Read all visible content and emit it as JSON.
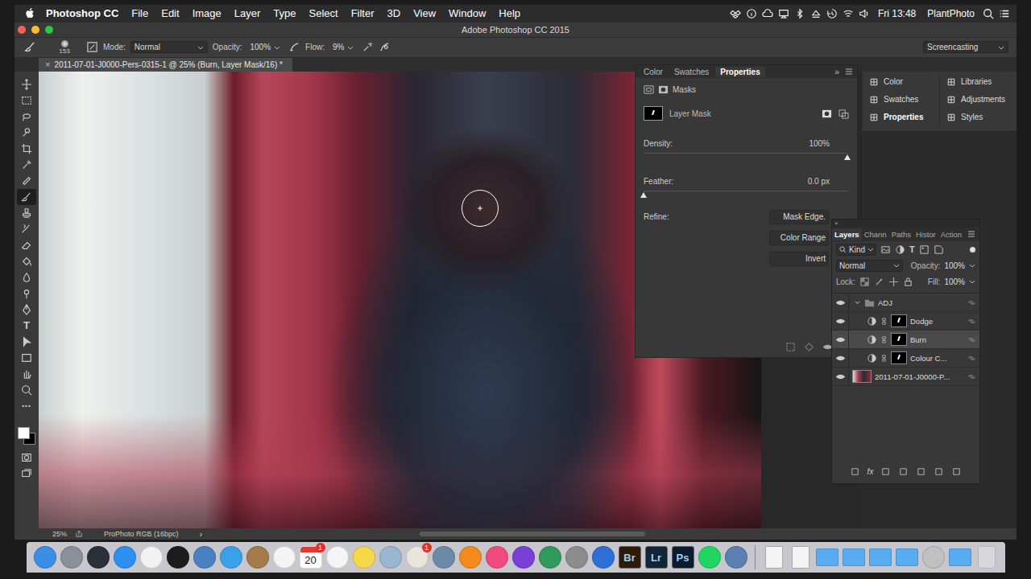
{
  "menubar": {
    "app": "Photoshop CC",
    "menus": [
      "File",
      "Edit",
      "Image",
      "Layer",
      "Type",
      "Select",
      "Filter",
      "3D",
      "View",
      "Window",
      "Help"
    ],
    "clock": "Fri 13:48",
    "user": "PlantPhoto"
  },
  "window": {
    "title": "Adobe Photoshop CC 2015"
  },
  "options_bar": {
    "brush_size": "153",
    "mode_label": "Mode:",
    "mode": "Normal",
    "opacity_label": "Opacity:",
    "opacity": "100%",
    "flow_label": "Flow:",
    "flow": "9%",
    "workspace": "Screencasting"
  },
  "document_tab": {
    "close": "×",
    "title": "2011-07-01-J0000-Pers-0315-1 @ 25% (Burn, Layer Mask/16) *"
  },
  "toolbar": {
    "tools": [
      {
        "selected": false
      },
      {
        "selected": false
      },
      {
        "selected": false
      },
      {
        "selected": false
      },
      {
        "selected": false
      },
      {
        "selected": false
      },
      {
        "selected": false
      },
      {
        "selected": true
      },
      {
        "selected": false
      },
      {
        "selected": false
      },
      {
        "selected": false
      },
      {
        "selected": false
      },
      {
        "selected": false
      },
      {
        "selected": false
      },
      {
        "selected": false
      },
      {
        "selected": false,
        "glyph": "T"
      },
      {
        "selected": false
      },
      {
        "selected": false
      },
      {
        "selected": false
      },
      {
        "selected": false
      },
      {
        "selected": false,
        "glyph": "•••"
      }
    ],
    "foreground": "#ffffff",
    "background": "#000000"
  },
  "properties_panel": {
    "tabs": [
      {
        "label": "Color",
        "selected": false
      },
      {
        "label": "Swatches",
        "selected": false
      },
      {
        "label": "Properties",
        "selected": true
      }
    ],
    "collapse": "»",
    "section": "Masks",
    "mask_label": "Layer Mask",
    "sliders": [
      {
        "label": "Density:",
        "reading": "100%",
        "level": 1
      },
      {
        "label": "Feather:",
        "reading": "0.0 px",
        "level": 0
      }
    ],
    "refine_label": "Refine:",
    "buttons": [
      "Mask Edge.",
      "Color Range",
      "Invert"
    ]
  },
  "panel_dock": {
    "columns": [
      [
        {
          "label": "Color",
          "selected": false
        },
        {
          "label": "Swatches",
          "selected": false
        },
        {
          "label": "Properties",
          "selected": true
        }
      ],
      [
        {
          "label": "Libraries",
          "selected": false
        },
        {
          "label": "Adjustments",
          "selected": false
        },
        {
          "label": "Styles",
          "selected": false
        }
      ]
    ]
  },
  "layers_panel": {
    "close": "×",
    "tabs": [
      {
        "label": "Layers",
        "selected": true
      },
      {
        "label": "Chann",
        "selected": false
      },
      {
        "label": "Paths",
        "selected": false
      },
      {
        "label": "Histor",
        "selected": false
      },
      {
        "label": "Action",
        "selected": false
      }
    ],
    "filter": "Kind",
    "filter_glyph": "T",
    "blend_mode": "Normal",
    "opacity_label": "Opacity:",
    "opacity": "100%",
    "lock_label": "Lock:",
    "fill_label": "Fill:",
    "fill": "100%",
    "layers": [
      {
        "name": "ADJ",
        "kind": "group",
        "visible": true,
        "expanded": true,
        "selected": false
      },
      {
        "name": "Dodge",
        "kind": "adjustment",
        "visible": true,
        "selected": false
      },
      {
        "name": "Burn",
        "kind": "adjustment",
        "visible": true,
        "selected": true
      },
      {
        "name": "Colour C...",
        "kind": "adjustment",
        "visible": true,
        "selected": false
      },
      {
        "name": "2011-07-01-J0000-P...",
        "kind": "image",
        "visible": true,
        "selected": false
      }
    ],
    "fx": "fx"
  },
  "status_bar": {
    "zoom": "25%",
    "profile": "ProPhoto RGB (16bpc)",
    "arrow": "›"
  },
  "dock": {
    "items": [
      {
        "kind": "app",
        "color": "#3a8ee6"
      },
      {
        "kind": "app",
        "color": "#8a8f99"
      },
      {
        "kind": "app",
        "color": "#2b2f3a"
      },
      {
        "kind": "app",
        "color": "#2d8ff0"
      },
      {
        "kind": "app",
        "color": "#f2f2f2"
      },
      {
        "kind": "app",
        "color": "#1c1c1c"
      },
      {
        "kind": "app",
        "color": "#4a7fc0"
      },
      {
        "kind": "app",
        "color": "#3aa0e8"
      },
      {
        "kind": "app",
        "color": "#a57a4a"
      },
      {
        "kind": "app",
        "color": "#f4f4f4"
      },
      {
        "kind": "calendar",
        "color": "#ffffff",
        "label": "20",
        "badge": "1"
      },
      {
        "kind": "app",
        "color": "#f5f5f5"
      },
      {
        "kind": "app",
        "color": "#f7d74a"
      },
      {
        "kind": "app",
        "color": "#9ab6d0"
      },
      {
        "kind": "app",
        "color": "#e9e4dc",
        "badge": "1"
      },
      {
        "kind": "app",
        "color": "#6c8aa8"
      },
      {
        "kind": "app",
        "color": "#f28a1c"
      },
      {
        "kind": "app",
        "color": "#f04a7e"
      },
      {
        "kind": "app",
        "color": "#7a3fd6"
      },
      {
        "kind": "app",
        "color": "#2f9a5a"
      },
      {
        "kind": "app",
        "color": "#8c8c8c"
      },
      {
        "kind": "app",
        "color": "#2c6fd6"
      },
      {
        "kind": "adobe",
        "color": "#2e1a08",
        "label": "Br"
      },
      {
        "kind": "adobe",
        "color": "#0e2636",
        "label": "Lr"
      },
      {
        "kind": "adobe",
        "color": "#0a1c30",
        "label": "Ps"
      },
      {
        "kind": "app",
        "color": "#1ed760"
      },
      {
        "kind": "app",
        "color": "#5a7fb0"
      },
      {
        "kind": "separator"
      },
      {
        "kind": "doc",
        "color": "#f4f4f4"
      },
      {
        "kind": "doc",
        "color": "#f4f4f4"
      },
      {
        "kind": "folder",
        "color": "#5aacf0"
      },
      {
        "kind": "folder",
        "color": "#5aacf0"
      },
      {
        "kind": "folder",
        "color": "#5aacf0"
      },
      {
        "kind": "folder",
        "color": "#5aacf0"
      },
      {
        "kind": "app",
        "color": "#c0c0c0"
      },
      {
        "kind": "folder",
        "color": "#5aacf0"
      },
      {
        "kind": "trash",
        "color": "#d8d8dc"
      }
    ]
  }
}
